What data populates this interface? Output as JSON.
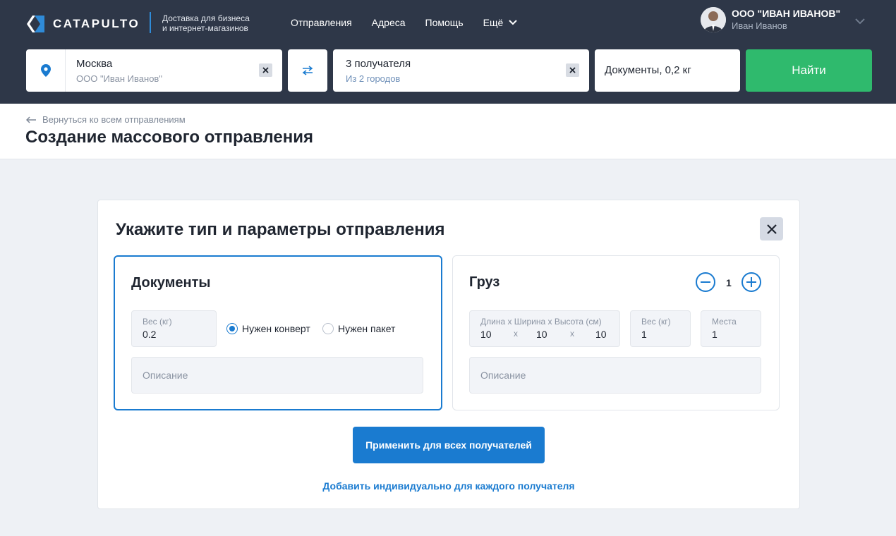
{
  "header": {
    "brand": "CATAPULTO",
    "tagline_line1": "Доставка для бизнеса",
    "tagline_line2": "и интернет-магазинов",
    "nav": [
      "Отправления",
      "Адреса",
      "Помощь"
    ],
    "nav_more": "Ещё",
    "user_company": "ООО \"ИВАН ИВАНОВ\"",
    "user_name": "Иван Иванов"
  },
  "search": {
    "from_city": "Москва",
    "from_company": "ООО \"Иван Иванов\"",
    "to_main": "3 получателя",
    "to_sub": "Из 2 городов",
    "cargo": "Документы, 0,2 кг",
    "find_label": "Найти"
  },
  "page": {
    "back_label": "Вернуться ко всем отправлениям",
    "title": "Создание массового отправления"
  },
  "modal": {
    "title": "Укажите тип и параметры отправления",
    "documents": {
      "title": "Документы",
      "weight_label": "Вес (кг)",
      "weight_value": "0.2",
      "radio_envelope": "Нужен конверт",
      "radio_package": "Нужен пакет",
      "selected_option": "envelope",
      "description_placeholder": "Описание"
    },
    "cargo": {
      "title": "Груз",
      "count": "1",
      "dims_label": "Длина x Ширина x Высота (см)",
      "length": "10",
      "width": "10",
      "height": "10",
      "dim_sep": "x",
      "weight_label": "Вес (кг)",
      "weight_value": "1",
      "places_label": "Места",
      "places_value": "1",
      "description_placeholder": "Описание"
    },
    "apply_label": "Применить для всех получателей",
    "add_individual_label": "Добавить индивидуально для каждого получателя"
  },
  "colors": {
    "header_bg": "#2e3748",
    "accent_blue": "#1a7bd0",
    "find_green": "#2fba6d",
    "page_bg": "#eef1f5"
  },
  "icons": [
    "logo-icon",
    "chevron-down-icon",
    "location-pin-icon",
    "clear-icon",
    "swap-icon",
    "arrow-left-icon",
    "close-icon",
    "minus-icon",
    "plus-icon"
  ]
}
